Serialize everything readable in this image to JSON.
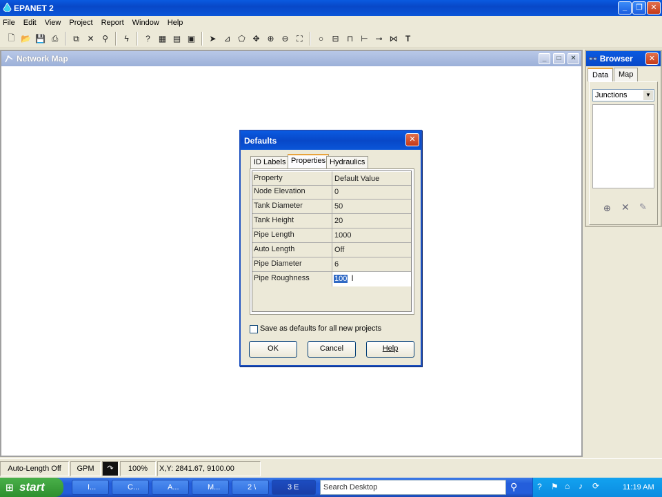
{
  "app": {
    "title": "EPANET 2"
  },
  "menu": [
    "File",
    "Edit",
    "View",
    "Project",
    "Report",
    "Window",
    "Help"
  ],
  "map_window": {
    "title": "Network Map"
  },
  "browser": {
    "title": "Browser",
    "tabs": [
      "Data",
      "Map"
    ],
    "selected": "Junctions"
  },
  "dialog": {
    "title": "Defaults",
    "tabs": [
      "ID Labels",
      "Properties",
      "Hydraulics"
    ],
    "active_tab": "Properties",
    "columns": [
      "Property",
      "Default Value"
    ],
    "rows": [
      {
        "property": "Node Elevation",
        "value": "0"
      },
      {
        "property": "Tank Diameter",
        "value": "50"
      },
      {
        "property": "Tank Height",
        "value": "20"
      },
      {
        "property": "Pipe Length",
        "value": "1000"
      },
      {
        "property": "Auto Length",
        "value": "Off"
      },
      {
        "property": "Pipe Diameter",
        "value": "6"
      },
      {
        "property": "Pipe Roughness",
        "value": "100"
      }
    ],
    "checkbox_label": "Save as defaults for all new projects",
    "buttons": {
      "ok": "OK",
      "cancel": "Cancel",
      "help": "Help"
    }
  },
  "status": {
    "auto_length": "Auto-Length Off",
    "units": "GPM",
    "zoom": "100%",
    "coords": "X,Y: 2841.67, 9100.00"
  },
  "taskbar": {
    "start": "start",
    "tasks": [
      "I...",
      "C...",
      "A...",
      "M...",
      "2 \\",
      "3 E"
    ],
    "search_placeholder": "Search Desktop",
    "clock": "11:19 AM"
  },
  "colors": {
    "titlebar": "#0a5ae0",
    "selection": "#316ac5"
  }
}
